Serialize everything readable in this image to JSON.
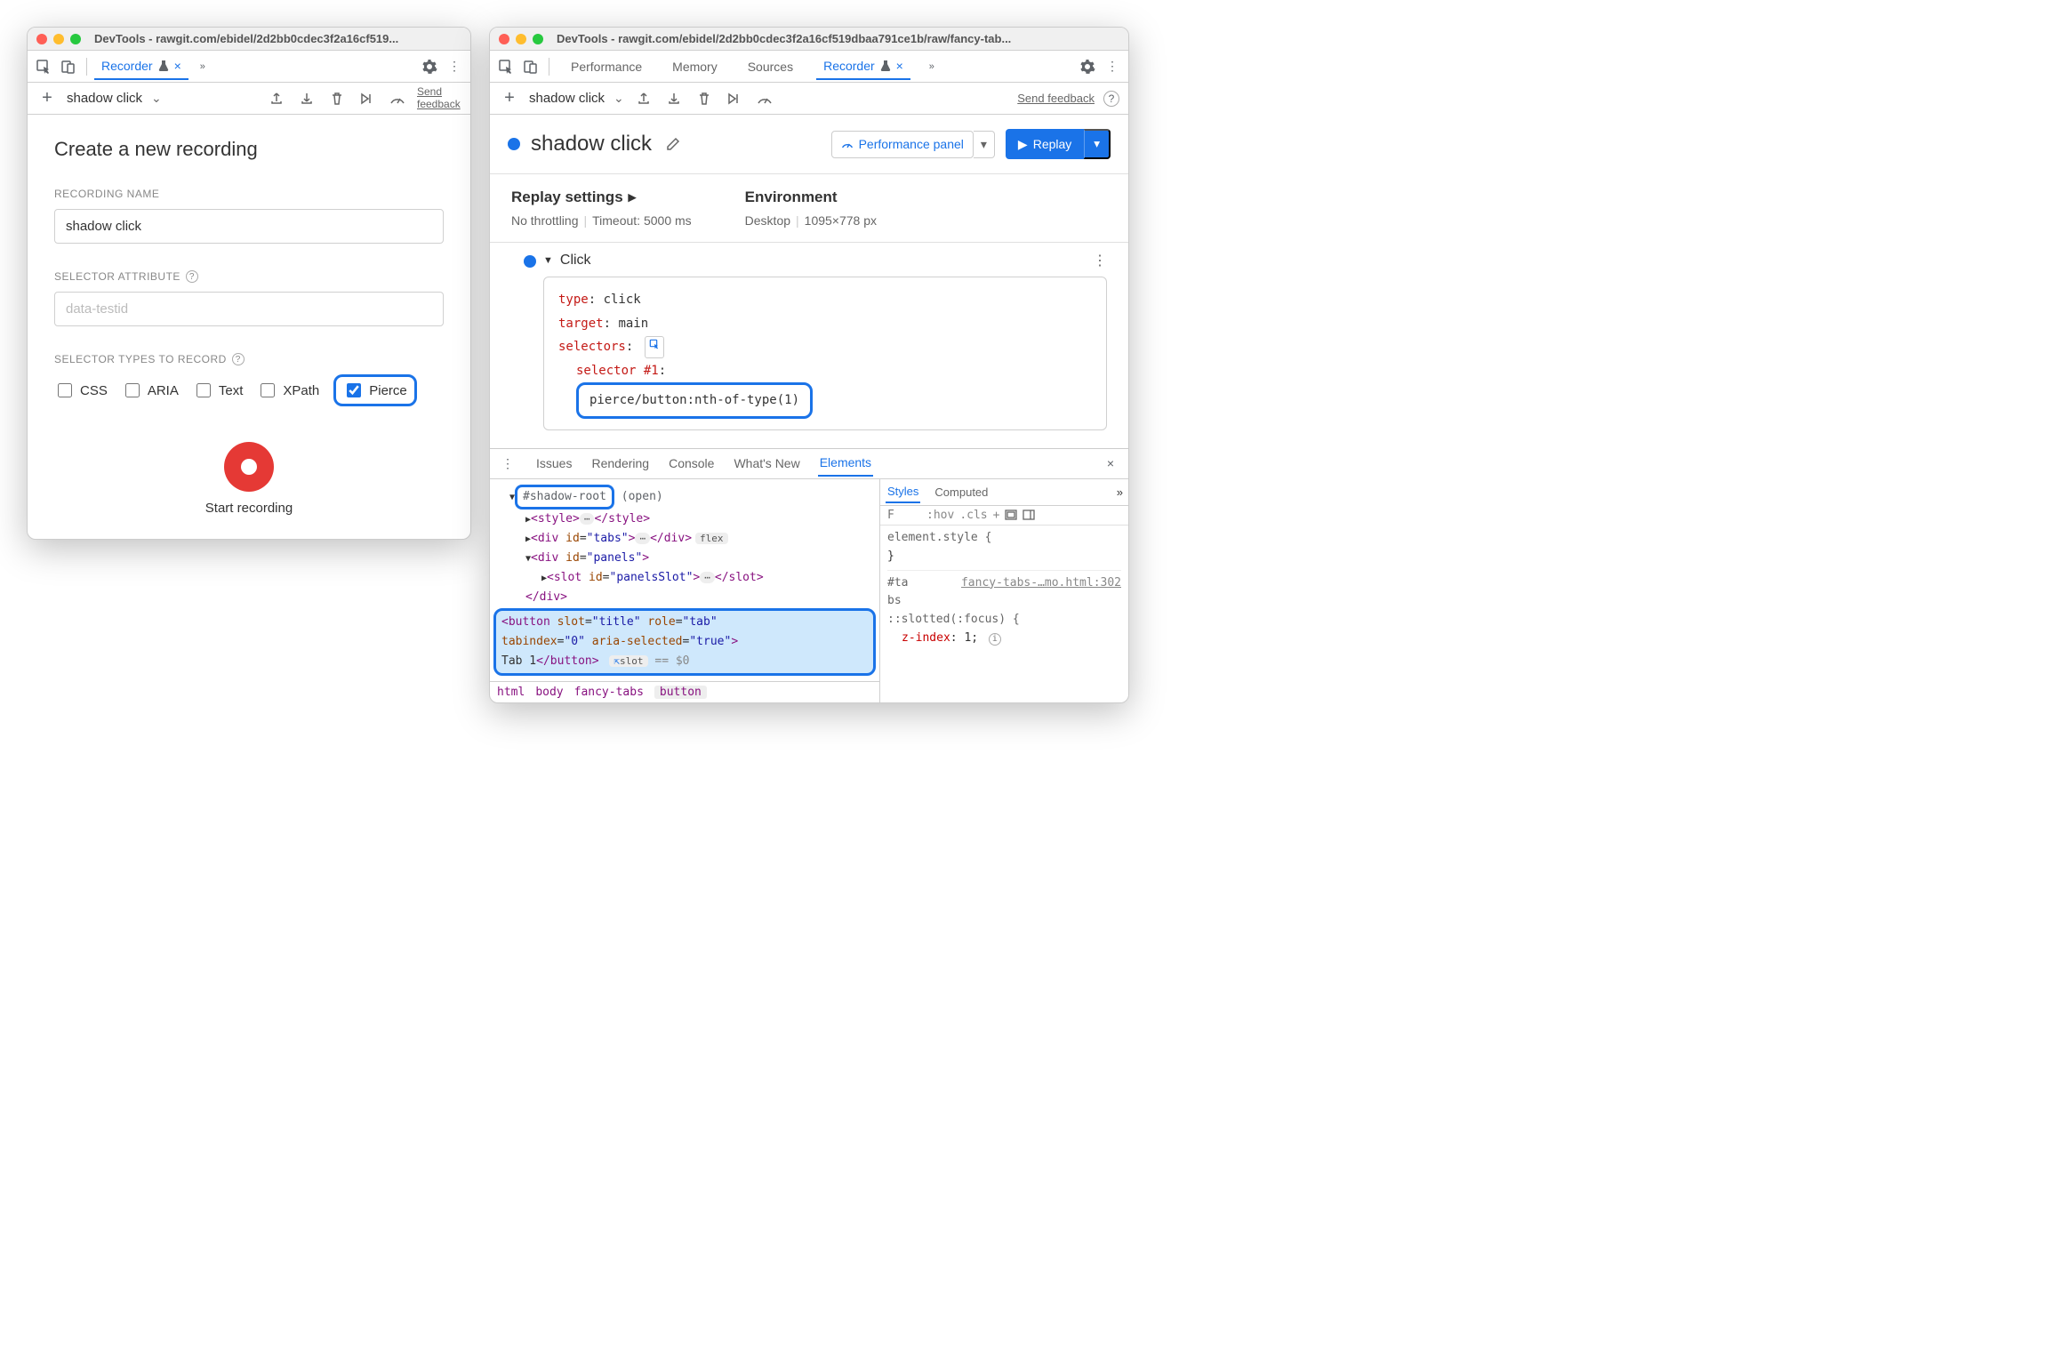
{
  "left": {
    "window_title": "DevTools - rawgit.com/ebidel/2d2bb0cdec3f2a16cf519...",
    "tab_recorder": "Recorder",
    "flow_name": "shadow click",
    "send_feedback": "Send feedback",
    "heading": "Create a new recording",
    "recording_name_label": "RECORDING NAME",
    "recording_name_value": "shadow click",
    "selector_attr_label": "SELECTOR ATTRIBUTE",
    "selector_attr_placeholder": "data-testid",
    "selector_types_label": "SELECTOR TYPES TO RECORD",
    "types": {
      "css": "CSS",
      "aria": "ARIA",
      "text": "Text",
      "xpath": "XPath",
      "pierce": "Pierce"
    },
    "start_recording": "Start recording"
  },
  "right": {
    "window_title": "DevTools - rawgit.com/ebidel/2d2bb0cdec3f2a16cf519dbaa791ce1b/raw/fancy-tab...",
    "tabs": {
      "performance": "Performance",
      "memory": "Memory",
      "sources": "Sources",
      "recorder": "Recorder"
    },
    "flow_name": "shadow click",
    "send_feedback": "Send feedback",
    "title": "shadow click",
    "perf_panel_btn": "Performance panel",
    "replay_btn": "Replay",
    "replay_settings": "Replay settings",
    "throttling": "No throttling",
    "timeout": "Timeout: 5000 ms",
    "environment": "Environment",
    "env_device": "Desktop",
    "env_viewport": "1095×778 px",
    "step_name": "Click",
    "step": {
      "type_k": "type",
      "type_v": "click",
      "target_k": "target",
      "target_v": "main",
      "selectors_k": "selectors",
      "sel_label": "selector #1",
      "sel_value": "pierce/button:nth-of-type(1)"
    },
    "drawer": {
      "tabs": {
        "issues": "Issues",
        "rendering": "Rendering",
        "console": "Console",
        "whatsnew": "What's New",
        "elements": "Elements"
      },
      "shadow_root": "#shadow-root",
      "shadow_open": "(open)",
      "tabs_id": "tabs",
      "panels_id": "panels",
      "slot_id": "panelsSlot",
      "flex_badge": "flex",
      "btn_line1": "<button slot=\"title\" role=\"tab\"",
      "btn_line2": "tabindex=\"0\" aria-selected=\"true\">",
      "btn_line3_a": "Tab 1",
      "btn_line3_b": "</button>",
      "slot_badge": "slot",
      "eq0": "== $0",
      "crumbs": {
        "html": "html",
        "body": "body",
        "ft": "fancy-tabs",
        "button": "button"
      }
    },
    "styles": {
      "tabs": {
        "styles": "Styles",
        "computed": "Computed"
      },
      "filter_placeholder": "F",
      "hov": ":hov",
      "cls": ".cls",
      "elstyle": "element.style {",
      "rbrace": "}",
      "tab_sel": "#ta bs",
      "src": "fancy-tabs-…mo.html:302",
      "slotted": "::slotted(:focus) {",
      "prop": "z-index",
      "val": "1"
    }
  }
}
